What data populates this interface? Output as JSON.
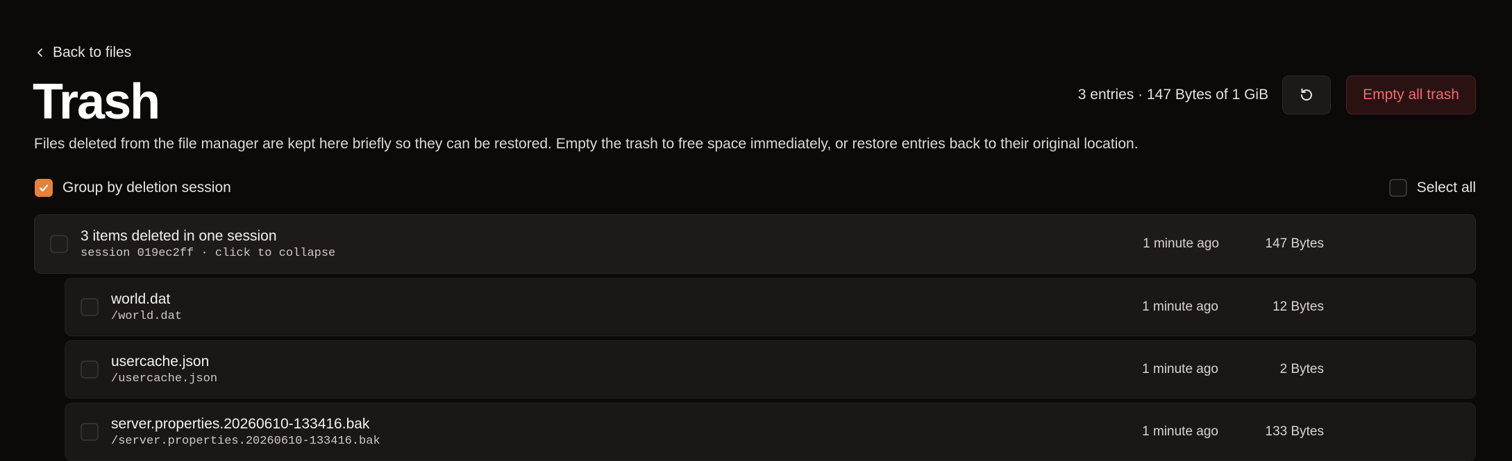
{
  "nav": {
    "back_label": "Back to files"
  },
  "header": {
    "title": "Trash",
    "description": "Files deleted from the file manager are kept here briefly so they can be restored. Empty the trash to free space immediately, or restore entries back to their original location.",
    "usage": "3 entries · 147 Bytes of 1 GiB",
    "empty_label": "Empty all trash"
  },
  "options": {
    "group_label": "Group by deletion session",
    "group_checked": true,
    "select_all_label": "Select all"
  },
  "group": {
    "title": "3 items deleted in one session",
    "subtitle": "session 019ec2ff · click to collapse",
    "time": "1 minute ago",
    "size": "147 Bytes"
  },
  "items": [
    {
      "name": "world.dat",
      "path": "/world.dat",
      "time": "1 minute ago",
      "size": "12 Bytes"
    },
    {
      "name": "usercache.json",
      "path": "/usercache.json",
      "time": "1 minute ago",
      "size": "2 Bytes"
    },
    {
      "name": "server.properties.20260610-133416.bak",
      "path": "/server.properties.20260610-133416.bak",
      "time": "1 minute ago",
      "size": "133 Bytes"
    }
  ],
  "colors": {
    "accent": "#e8813a",
    "danger": "#ef6a6e",
    "background": "#0b0a09"
  },
  "icons": {
    "back": "chevron-left-icon",
    "refresh": "refresh-icon",
    "check": "check-icon"
  }
}
